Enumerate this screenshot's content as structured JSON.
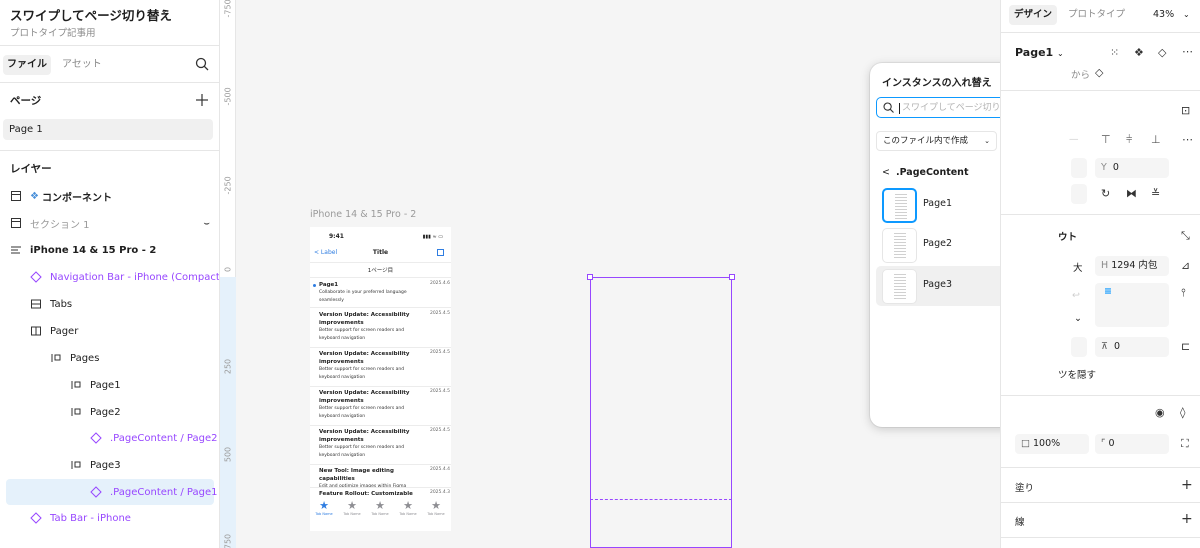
{
  "left": {
    "file_title": "スワイプしてページ切り替え",
    "file_sub": "プロトタイプ記事用",
    "tab_file": "ファイル",
    "tab_asset": "アセット",
    "pages_label": "ページ",
    "page1": "Page 1",
    "layers_label": "レイヤー",
    "layers": [
      {
        "label": "コンポーネント"
      },
      {
        "label": "セクション 1"
      },
      {
        "label": "iPhone 14 & 15 Pro - 2"
      },
      {
        "label": "Navigation Bar - iPhone (Compact Size)"
      },
      {
        "label": "Tabs"
      },
      {
        "label": "Pager"
      },
      {
        "label": "Pages"
      },
      {
        "label": "Page1"
      },
      {
        "label": "Page2"
      },
      {
        "label": ".PageContent / Page2"
      },
      {
        "label": "Page3"
      },
      {
        "label": ".PageContent / Page1"
      },
      {
        "label": "Tab Bar - iPhone"
      }
    ]
  },
  "canvas": {
    "ruler_ticks": [
      "-750",
      "-500",
      "-250",
      "0",
      "250",
      "500",
      "750"
    ],
    "frame_label": "iPhone 14 & 15 Pro - 2",
    "phone": {
      "time": "9:41",
      "status": "▮▮▮ ≈ ▭",
      "back": "< Label",
      "title": "Title",
      "subtitle": "1ページ目",
      "items": [
        {
          "title": "Page1",
          "desc": "Collaborate in your preferred language seamlessly",
          "date": "2025.4.6"
        },
        {
          "title": "Version Update: Accessibility improvements",
          "desc": "Better support for screen readers and keyboard navigation",
          "date": "2025.4.5"
        },
        {
          "title": "Version Update: Accessibility improvements",
          "desc": "Better support for screen readers and keyboard navigation",
          "date": "2025.4.5"
        },
        {
          "title": "Version Update: Accessibility improvements",
          "desc": "Better support for screen readers and keyboard navigation",
          "date": "2025.4.5"
        },
        {
          "title": "Version Update: Accessibility improvements",
          "desc": "Better support for screen readers and keyboard navigation",
          "date": "2025.4.5"
        },
        {
          "title": "New Tool: Image editing capabilities",
          "desc": "Edit and optimize images within Figma",
          "date": "2025.4.4"
        },
        {
          "title": "Feature Rollout: Customizable",
          "desc": "",
          "date": "2025.4.3"
        }
      ],
      "tab_label": "Tab Name"
    }
  },
  "popup": {
    "title": "インスタンスの入れ替え",
    "search_placeholder": "スワイプしてページ切り替えを検索",
    "filter": "このファイル内で作成",
    "back_label": ".PageContent",
    "options": [
      {
        "label": "Page1"
      },
      {
        "label": "Page2"
      },
      {
        "label": "Page3"
      }
    ]
  },
  "right": {
    "tab_design": "デザイン",
    "tab_proto": "プロトタイプ",
    "zoom": "43%",
    "page_name": "Page1",
    "from_text": "から",
    "y_label": "Y",
    "y_value": "0",
    "layout_partial": "ウト",
    "w_partial": "大",
    "h_label": "H",
    "h_value": "1294",
    "h_mode": "内包",
    "gap_value": "0",
    "clip_text": "ツを隠す",
    "opacity": "100%",
    "radius": "0",
    "fill_label": "塗り",
    "stroke_label": "線"
  }
}
